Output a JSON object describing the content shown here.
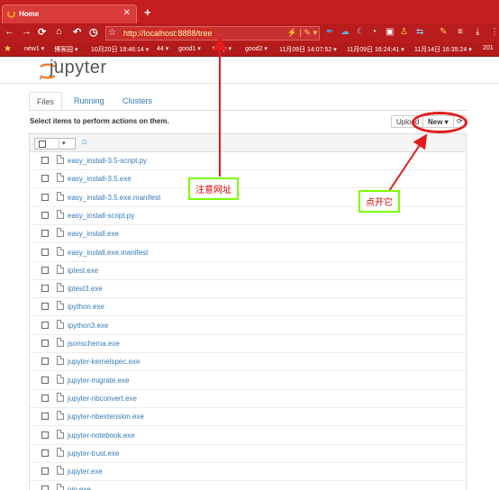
{
  "browser": {
    "tab_title": "Home",
    "tab_close": "✕",
    "new_tab": "+",
    "nav": {
      "back": "←",
      "forward": "→",
      "reload": "⟳",
      "home": "⌂",
      "undo": "↶",
      "history": "◷"
    },
    "url_star": "☆",
    "url": "http://localhost:8888/tree",
    "url_actions": "⚡ | ✎ ▾",
    "bookmarks_star": "★",
    "bookmarks": [
      "new1 ▾",
      "博客园 ▾",
      "10月20日 18:46:14 ▾",
      "44 ▾",
      "good1 ▾",
      "temp ▾",
      "good2 ▾",
      "11月09日 14:07:52 ▾",
      "11月09日 16:24:41 ▾",
      "11月14日 16:35:24 ▾",
      "201"
    ]
  },
  "jupyter": {
    "brand": "jupyter",
    "tabs": [
      "Files",
      "Running",
      "Clusters"
    ],
    "hint": "Select items to perform actions on them.",
    "upload_label": "Upload",
    "new_label": "New ▾",
    "refresh_icon": "⟳",
    "selector_caret": "▾",
    "home_icon": "⌂",
    "files": [
      "easy_install-3.5-script.py",
      "easy_install-3.5.exe",
      "easy_install-3.5.exe.manifest",
      "easy_install-script.py",
      "easy_install.exe",
      "easy_install.exe.manifest",
      "iptest.exe",
      "iptest3.exe",
      "ipython.exe",
      "ipython3.exe",
      "jsonschema.exe",
      "jupyter-kernelspec.exe",
      "jupyter-migrate.exe",
      "jupyter-nbconvert.exe",
      "jupyter-nbextension.exe",
      "jupyter-notebook.exe",
      "jupyter-trust.exe",
      "jupyter.exe",
      "pip.exe"
    ]
  },
  "annotations": {
    "url_note": "注意网址",
    "open_note": "点开它",
    "color": "#e21b1b"
  }
}
